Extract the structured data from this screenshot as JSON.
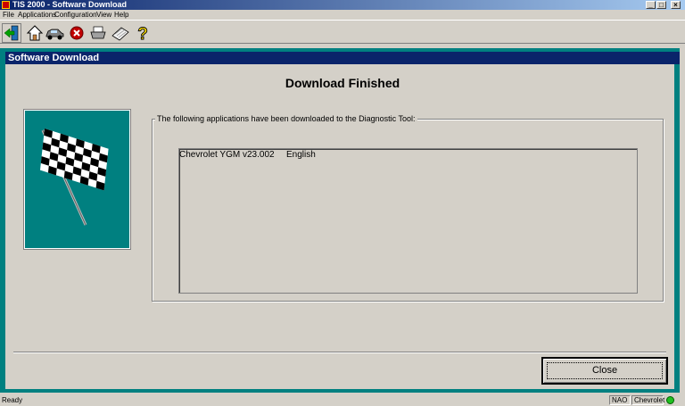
{
  "window": {
    "title": "TIS 2000 - Software Download"
  },
  "menu": [
    "File",
    "Applications",
    "Configuration",
    "View",
    "Help"
  ],
  "toolbar": {
    "icons": [
      "exit-icon",
      "home-icon",
      "car-icon",
      "stop-icon",
      "printer-icon",
      "notebook-icon",
      "help-icon"
    ]
  },
  "panel": {
    "header": "Software Download",
    "heading": "Download Finished",
    "group_label": "The following applications have been downloaded to the Diagnostic Tool:",
    "downloads": [
      {
        "name": "Chevrolet YGM",
        "version": "v23.002",
        "language": "English"
      }
    ],
    "close_label": "Close"
  },
  "status": {
    "left": "Ready",
    "region": "NAO",
    "brand": "Chevrolet"
  },
  "colors": {
    "teal": "#008080",
    "header": "#0a246a",
    "face": "#d4d0c8"
  }
}
